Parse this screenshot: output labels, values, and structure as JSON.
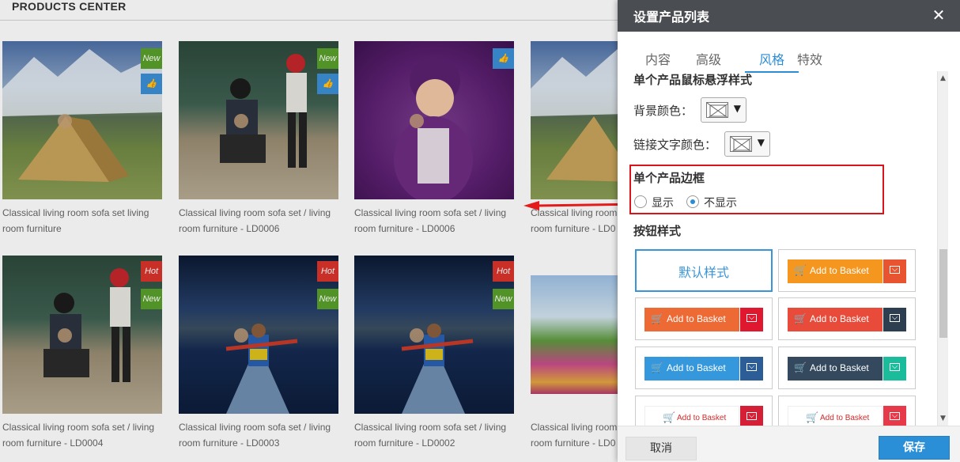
{
  "background": {
    "section_title": "PRODUCTS CENTER",
    "products": [
      {
        "caption": "Classical living room sofa set living room furniture",
        "badges": [
          "New",
          "like"
        ],
        "image": "mountain-tent"
      },
      {
        "caption": "Classical living room sofa set / living room furniture - LD0006",
        "badges": [
          "New",
          "like"
        ],
        "image": "baseball-kids"
      },
      {
        "caption": "Classical living room sofa set / living room furniture - LD0006",
        "badges": [
          "like"
        ],
        "image": "girl-purple-costume"
      },
      {
        "caption": "Classical living room sofa set / living room furniture - LD0",
        "badges": [],
        "image": "mountain-tent"
      },
      {
        "caption": "Classical living room sofa set / living room furniture - LD0004",
        "badges": [
          "Hot",
          "New"
        ],
        "image": "baseball-kids"
      },
      {
        "caption": "Classical living room sofa set / living room furniture - LD0003",
        "badges": [
          "Hot",
          "New"
        ],
        "image": "kayak-lake"
      },
      {
        "caption": "Classical living room sofa set / living room furniture - LD0002",
        "badges": [
          "Hot",
          "New"
        ],
        "image": "kayak-lake"
      },
      {
        "caption": "Classical living room sofa set / living room furniture - LD0",
        "badges": [],
        "image": "flower-field"
      }
    ]
  },
  "dialog": {
    "title": "设置产品列表",
    "close_icon": "close-icon",
    "tabs": [
      {
        "label": "内容",
        "active": false
      },
      {
        "label": "高级",
        "active": false
      },
      {
        "label": "风格",
        "active": true
      },
      {
        "label": "特效",
        "active": false
      }
    ],
    "hover_section": {
      "title": "单个产品鼠标悬浮样式",
      "bg_color_label": "背景颜色：",
      "link_text_color_label": "链接文字颜色："
    },
    "border_section": {
      "title": "单个产品边框",
      "options": [
        {
          "label": "显示",
          "selected": false
        },
        {
          "label": "不显示",
          "selected": true
        }
      ]
    },
    "button_section": {
      "title": "按钮样式",
      "default_label": "默认样式",
      "basket_label": "Add to Basket",
      "styles": [
        {
          "kind": "default",
          "selected": true
        },
        {
          "kind": "basket",
          "main": "#f5961e",
          "side": "#e8542f"
        },
        {
          "kind": "basket",
          "main": "#ee6a34",
          "side": "#e0182f"
        },
        {
          "kind": "basket",
          "main": "#e84b3a",
          "side": "#2d3e50"
        },
        {
          "kind": "basket",
          "main": "#3598dc",
          "side": "#2c5d97"
        },
        {
          "kind": "basket",
          "main": "#34495e",
          "side": "#1bbc9b"
        },
        {
          "kind": "basket-light",
          "main": "#ffffff",
          "side": "#d41f36"
        },
        {
          "kind": "basket-light",
          "main": "#ffffff",
          "side": "#e6394a"
        }
      ]
    },
    "footer": {
      "cancel_label": "取消",
      "save_label": "保存"
    }
  },
  "colors": {
    "accent": "#2b8dd6",
    "dialog_header": "#4a4d51",
    "highlight": "#d9151b"
  }
}
